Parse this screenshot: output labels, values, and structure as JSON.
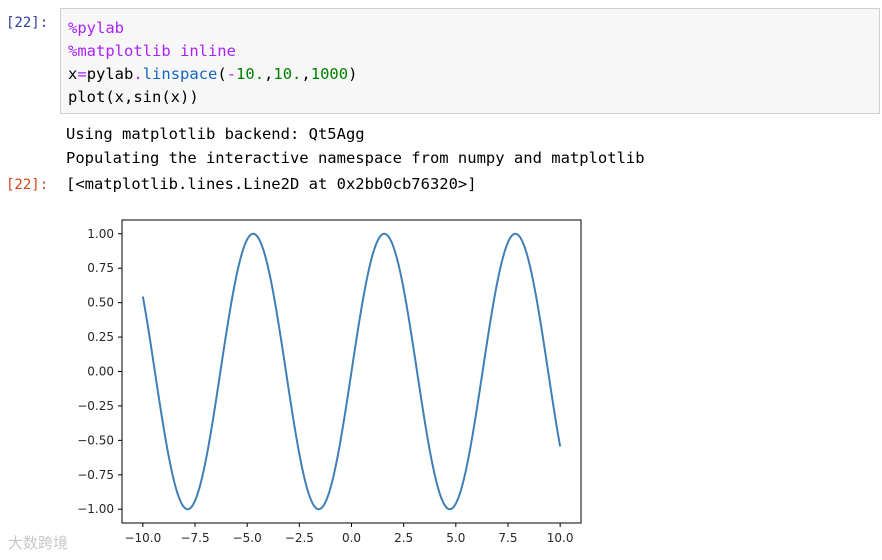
{
  "input_prompt": "[22]:",
  "output_prompt": "[22]:",
  "code_cell": {
    "lines": [
      [
        {
          "t": "%pylab",
          "c": "magic"
        }
      ],
      [
        {
          "t": "%matplotlib inline",
          "c": "magic"
        }
      ],
      [
        {
          "t": "x",
          "c": ""
        },
        {
          "t": "=",
          "c": "op"
        },
        {
          "t": "pylab",
          "c": ""
        },
        {
          "t": ".",
          "c": "op"
        },
        {
          "t": "linspace",
          "c": "attr"
        },
        {
          "t": "(",
          "c": ""
        },
        {
          "t": "-",
          "c": "op"
        },
        {
          "t": "10.",
          "c": "num"
        },
        {
          "t": ",",
          "c": ""
        },
        {
          "t": "10.",
          "c": "num"
        },
        {
          "t": ",",
          "c": ""
        },
        {
          "t": "1000",
          "c": "num"
        },
        {
          "t": ")",
          "c": ""
        }
      ],
      [
        {
          "t": "plot(x,sin(x))",
          "c": ""
        }
      ]
    ]
  },
  "stream_output": {
    "line1": "Using matplotlib backend: Qt5Agg",
    "line2": "Populating the interactive namespace from numpy and matplotlib"
  },
  "execute_result": "[<matplotlib.lines.Line2D at 0x2bb0cb76320>]",
  "watermark": "大数跨境",
  "colors": {
    "line": "#3f7fb5",
    "axes": "#000000",
    "input_prompt": "#303f9f",
    "output_prompt": "#d84315"
  },
  "chart_data": {
    "type": "line",
    "function": "sin",
    "x_range": [
      -10.0,
      10.0
    ],
    "num_points": 1000,
    "xlim": [
      -11.0,
      11.0
    ],
    "ylim": [
      -1.1,
      1.1
    ],
    "xticks": [
      -10.0,
      -7.5,
      -5.0,
      -2.5,
      0.0,
      2.5,
      5.0,
      7.5,
      10.0
    ],
    "xtick_labels": [
      "−10.0",
      "−7.5",
      "−5.0",
      "−2.5",
      "0.0",
      "2.5",
      "5.0",
      "7.5",
      "10.0"
    ],
    "yticks": [
      1.0,
      0.75,
      0.5,
      0.25,
      0.0,
      -0.25,
      -0.5,
      -0.75,
      -1.0
    ],
    "ytick_labels": [
      "1.00",
      "0.75",
      "0.50",
      "0.25",
      "0.00",
      "−0.25",
      "−0.50",
      "−0.75",
      "−1.00"
    ],
    "grid": false,
    "title": "",
    "xlabel": "",
    "ylabel": ""
  }
}
